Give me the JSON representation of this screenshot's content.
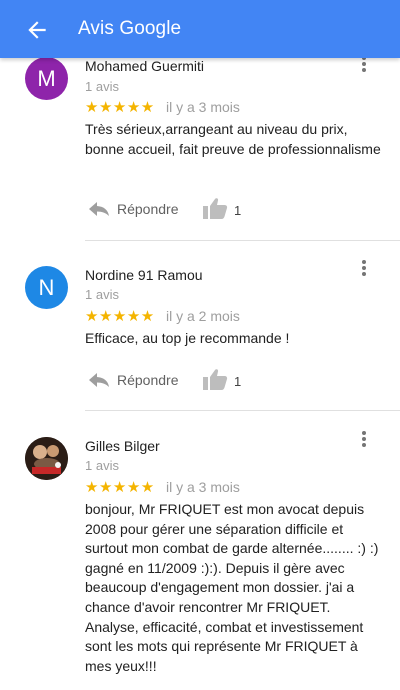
{
  "appbar": {
    "title": "Avis Google"
  },
  "colors": {
    "appbar": "#4285f4",
    "stars": "#f4b400",
    "avatar_m": "#8e24aa",
    "avatar_n": "#1e88e5"
  },
  "reviews": [
    {
      "avatar_letter": "M",
      "name": "Mohamed Guermiti",
      "count": "1 avis",
      "stars": "★★★★★",
      "rating": 5,
      "date": "il y a 3 mois",
      "text": "Très sérieux,arrangeant au niveau du prix, bonne accueil, fait preuve de professionnalisme",
      "reply": "Répondre",
      "likes": "1"
    },
    {
      "avatar_letter": "N",
      "name": "Nordine 91 Ramou",
      "count": "1 avis",
      "stars": "★★★★★",
      "rating": 5,
      "date": "il y a 2 mois",
      "text": "Efficace, au top je recommande !",
      "reply": "Répondre",
      "likes": "1"
    },
    {
      "avatar_letter": "",
      "name": "Gilles Bilger",
      "count": "1 avis",
      "stars": "★★★★★",
      "rating": 5,
      "date": "il y a 3 mois",
      "text": "bonjour, Mr FRIQUET est mon avocat depuis 2008 pour gérer une séparation difficile et surtout mon combat de garde alternée........ :) :) gagné en 11/2009 :):). Depuis il gère avec beaucoup d'engagement mon dossier. j'ai a chance d'avoir rencontrer Mr FRIQUET. Analyse, efficacité, combat et investissement sont les mots qui représente Mr FRIQUET à mes yeux!!!"
    }
  ]
}
